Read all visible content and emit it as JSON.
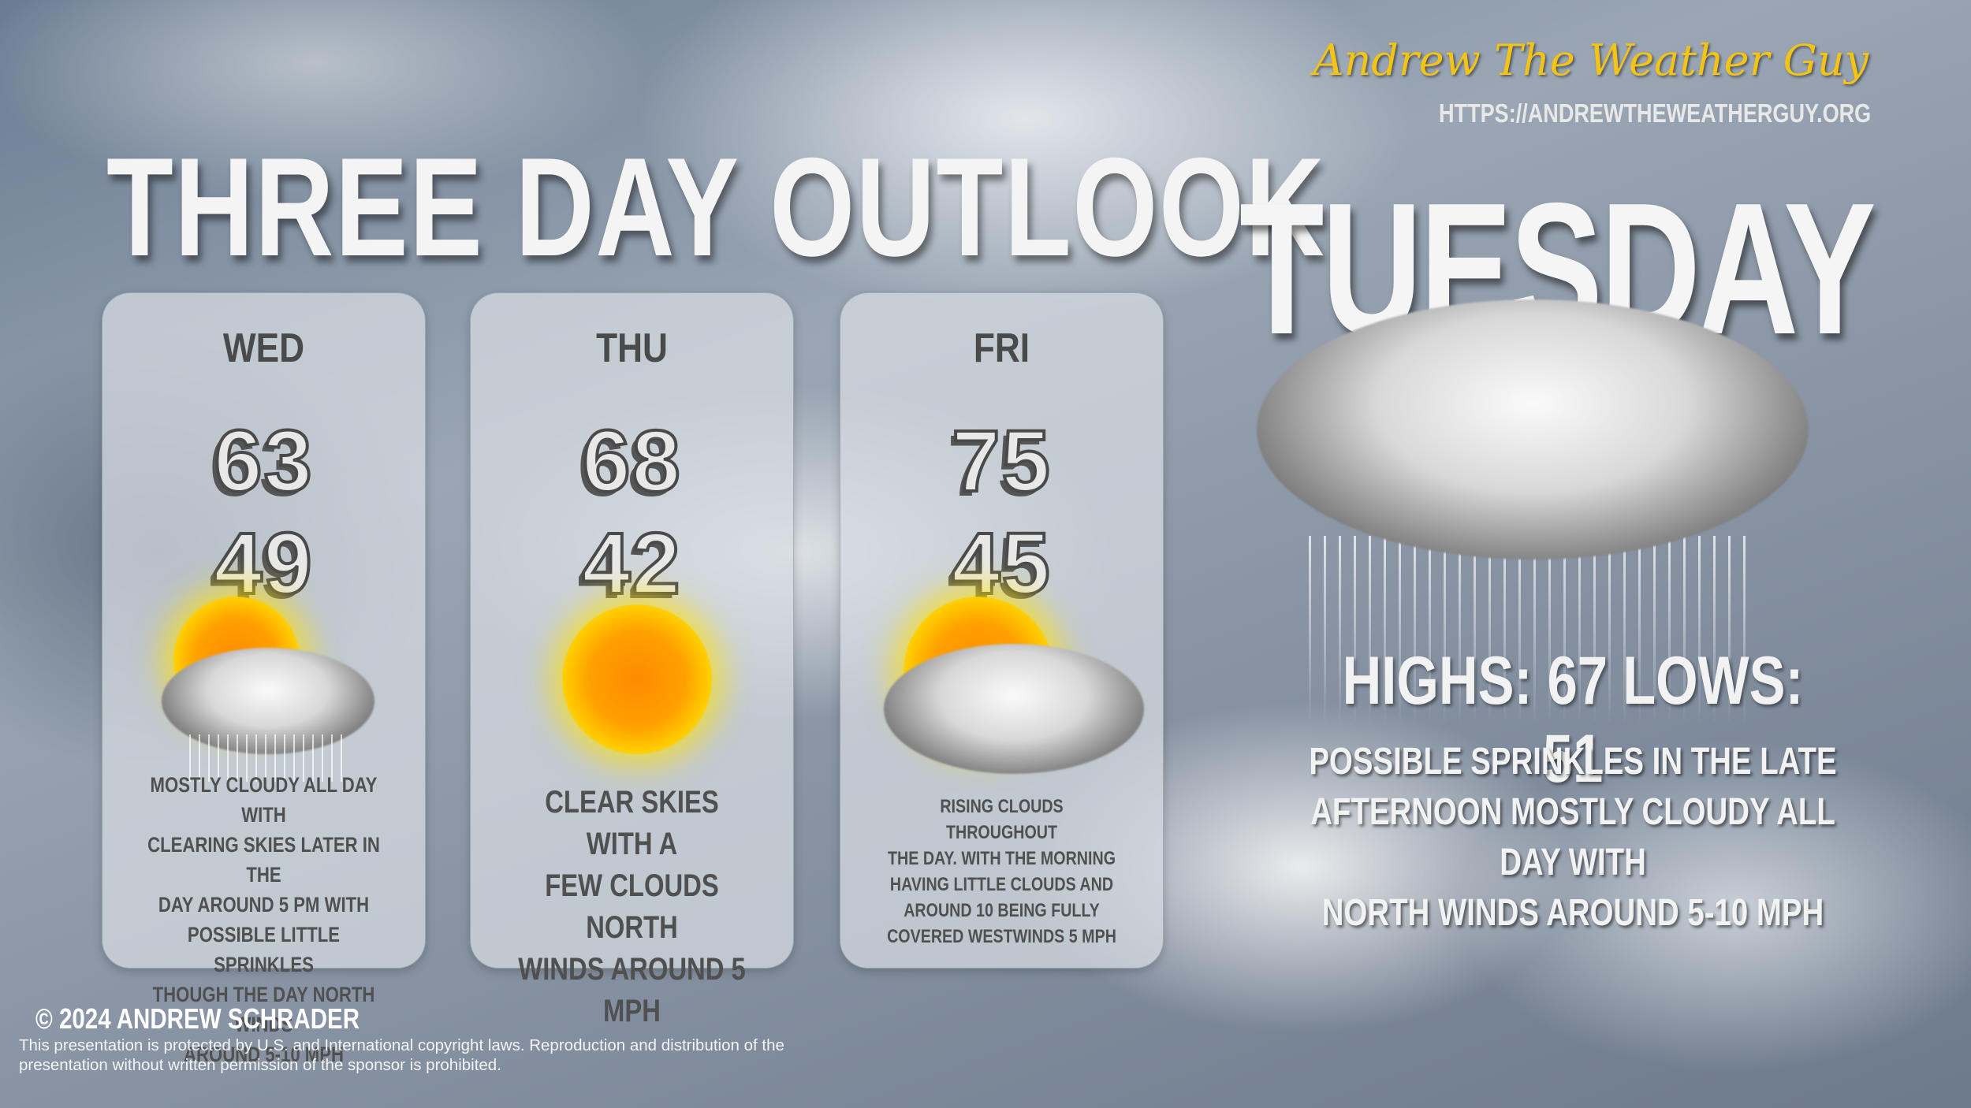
{
  "title": "THREE DAY OUTLOOK",
  "branding": {
    "name": "Andrew The Weather Guy",
    "url": "HTTPS://ANDREWTHEWEATHERGUY.ORG",
    "accent": "#f3c316"
  },
  "today": {
    "day": "TUESDAY",
    "icon": "rain-cloud-icon",
    "summary": "HIGHS: 67 LOWS: 51",
    "highs": "67",
    "lows": "51",
    "description": [
      "POSSIBLE SPRINKLES IN THE LATE",
      "AFTERNOON MOSTLY CLOUDY ALL DAY WITH",
      "NORTH WINDS AROUND 5-10 MPH"
    ]
  },
  "days": [
    {
      "day": "WED",
      "high": "63",
      "low": "49",
      "icon": "partly-cloudy-sprinkles-icon",
      "description": [
        "MOSTLY CLOUDY ALL DAY WITH",
        "CLEARING SKIES LATER IN THE",
        "DAY AROUND 5 PM WITH",
        "POSSIBLE LITTLE SPRINKLES",
        "THOUGH THE DAY NORTH WINDS",
        "AROUND 5-10 MPH"
      ]
    },
    {
      "day": "THU",
      "high": "68",
      "low": "42",
      "icon": "sun-icon",
      "description": [
        "CLEAR SKIES WITH A",
        "FEW CLOUDS NORTH",
        "WINDS AROUND 5 MPH"
      ]
    },
    {
      "day": "FRI",
      "high": "75",
      "low": "45",
      "icon": "partly-cloudy-icon",
      "description": [
        "RISING CLOUDS THROUGHOUT",
        "THE DAY. WITH THE MORNING",
        "HAVING LITTLE CLOUDS AND",
        "AROUND 10 BEING FULLY",
        "COVERED WESTWINDS 5 MPH"
      ]
    }
  ],
  "footer": {
    "copyright": "© 2024 ANDREW SCHRADER",
    "legal": "This presentation is protected by U.S. and International copyright laws. Reproduction and distribution of the presentation without written permission of the sponsor is prohibited."
  }
}
